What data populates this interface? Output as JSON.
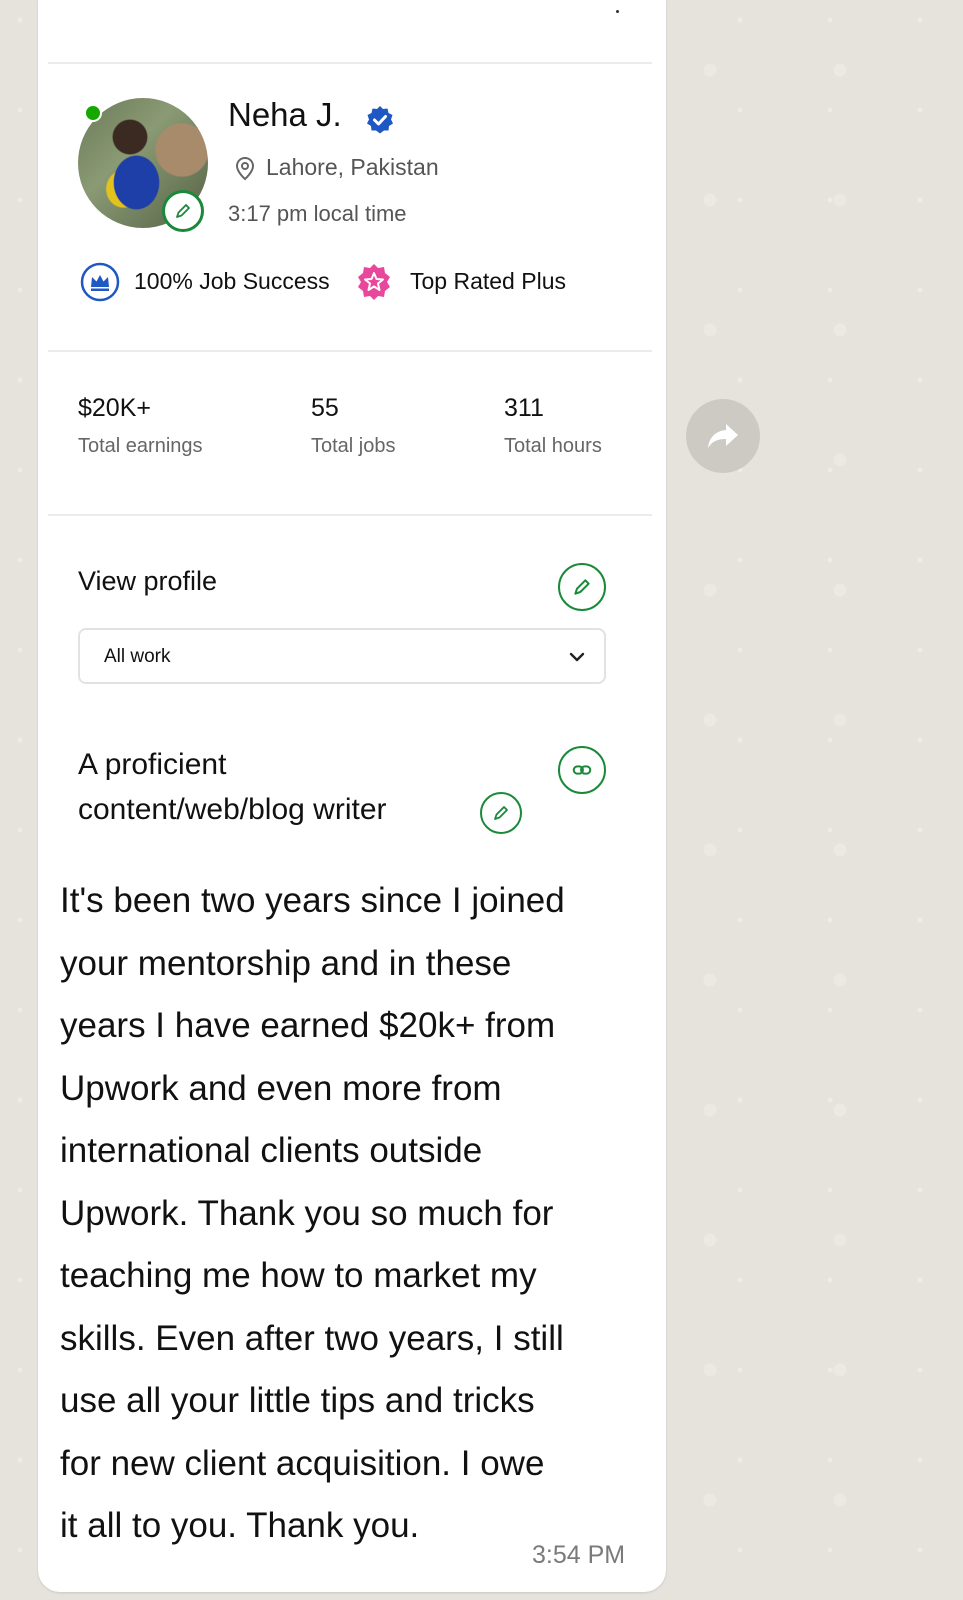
{
  "profile": {
    "name": "Neha J.",
    "location": "Lahore, Pakistan",
    "local_time": "3:17 pm local time",
    "badges": [
      {
        "label": "100% Job Success",
        "icon": "crown-icon",
        "color": "#1f57c3"
      },
      {
        "label": "Top Rated Plus",
        "icon": "star-badge-icon",
        "color": "#e8479b"
      }
    ],
    "online_color": "#14a800"
  },
  "stats": [
    {
      "value": "$20K+",
      "label": "Total earnings"
    },
    {
      "value": "55",
      "label": "Total jobs"
    },
    {
      "value": "311",
      "label": "Total hours"
    }
  ],
  "view_profile": {
    "label": "View profile",
    "select_value": "All work"
  },
  "headline": {
    "line1": "A proficient",
    "line2": "content/web/blog writer"
  },
  "message": {
    "lines": [
      "It's been two years since I joined",
      "your mentorship and in these",
      "years I have earned $20k+ from",
      "Upwork and even more from",
      "international clients outside",
      "Upwork. Thank you so much for",
      "teaching me how to market my",
      "skills. Even after two years, I still",
      "use all your little tips and tricks",
      "for new client acquisition. I owe",
      "it all to you. Thank you."
    ],
    "time": "3:54 PM"
  },
  "colors": {
    "accent_green": "#1a8a3a",
    "verified_blue": "#1f57c3",
    "chat_background": "#e6e2dc"
  }
}
